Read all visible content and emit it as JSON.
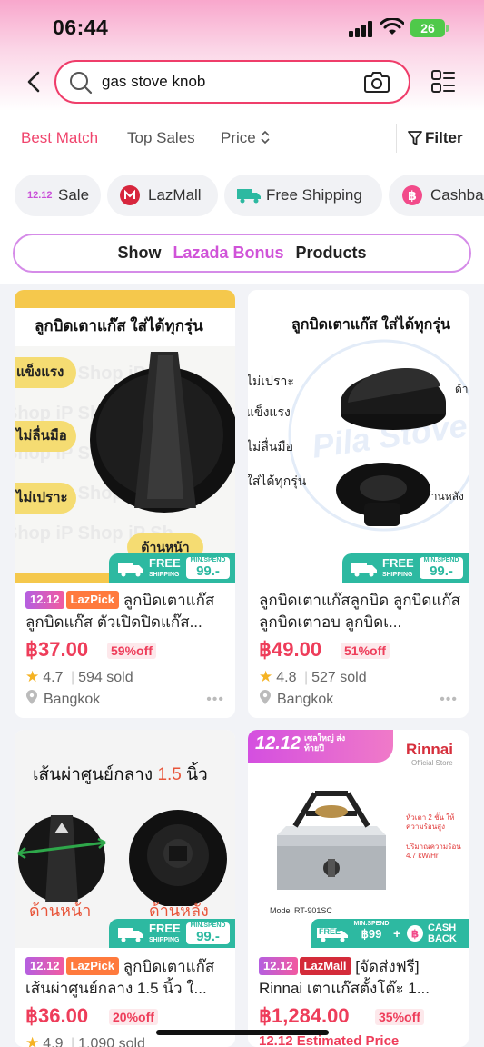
{
  "status_bar": {
    "time": "06:44",
    "battery": "26"
  },
  "search": {
    "query": "gas stove knob"
  },
  "sort": {
    "best_match": "Best Match",
    "top_sales": "Top Sales",
    "price": "Price",
    "filter": "Filter"
  },
  "chips": [
    {
      "badge": "12.12",
      "label": "Sale"
    },
    {
      "label": "LazMall"
    },
    {
      "label": "Free Shipping"
    },
    {
      "label": "Cashba"
    }
  ],
  "bonus": {
    "show": "Show",
    "lazada_bonus": "Lazada Bonus",
    "products": "Products"
  },
  "products": [
    {
      "image_title": "ลูกบิดเตาแก๊ส ใส่ได้ทุกรุ่น",
      "image_labels": [
        "แข็งแรง",
        "ไม่ลื่นมือ",
        "ไม่เปราะ",
        "ด้านหน้า"
      ],
      "watermark": "Shop iP Shop iP Sh",
      "tags": [
        "12.12",
        "LazPick"
      ],
      "title": "ลูกบิดเตาแก๊ส ลูกบิดแก๊ส ตัวเปิดปิดแก๊ส...",
      "price": "฿37.00",
      "discount": "59%off",
      "rating": "4.7",
      "sold": "594 sold",
      "location": "Bangkok",
      "shipping": {
        "free": "FREE",
        "free_sub": "SHIPPING",
        "min_label": "MIN.SPEND",
        "min_value": "99.-"
      }
    },
    {
      "image_title": "ลูกบิดเตาแก๊ส ใส่ได้ทุกรุ่น",
      "image_labels": [
        "ไม่เปราะ",
        "แข็งแรง",
        "ไม่ลื่นมือ",
        "ใส่ได้ทุกรุ่น",
        "ด้านหน้า",
        "ด้านหลัง"
      ],
      "watermark": "Pila Stove",
      "tags": [],
      "title": "ลูกบิดเตาแก๊สลูกบิด ลูกบิดแก๊ส ลูกบิดเตาอบ ลูกบิดเ...",
      "price": "฿49.00",
      "discount": "51%off",
      "rating": "4.8",
      "sold": "527 sold",
      "location": "Bangkok",
      "shipping": {
        "free": "FREE",
        "free_sub": "SHIPPING",
        "min_label": "MIN.SPEND",
        "min_value": "99.-"
      }
    },
    {
      "image_title": "เส้นผ่าศูนย์กลาง",
      "image_size": "1.5",
      "image_unit": "นิ้ว",
      "image_labels": [
        "ด้านหน้า",
        "ด้านหลัง"
      ],
      "tags": [
        "12.12",
        "LazPick"
      ],
      "title": "ลูกบิดเตาแก๊ส เส้นผ่าศูนย์กลาง 1.5 นิ้ว ใ...",
      "price": "฿36.00",
      "discount": "20%off",
      "rating": "4.9",
      "sold": "1,090 sold",
      "shipping": {
        "free": "FREE",
        "free_sub": "SHIPPING",
        "min_label": "MIN.SPEND",
        "min_value": "99.-"
      }
    },
    {
      "image_banner": "12.12",
      "image_banner_sub": "เซลใหญ่ ส่งท้ายปี",
      "brand": "Rinnai",
      "brand_sub": "Official Store",
      "image_notes": [
        "หัวเตา 2 ชั้น ให้ความร้อนสูง",
        "ปริมาณความร้อน 4.7 kW/Hr"
      ],
      "model": "Model  RT-901SC",
      "promo": {
        "free": "FREE",
        "min_label": "MIN.SPEND",
        "min_value": "฿99",
        "cash": "CASH BACK"
      },
      "tags": [
        "12.12",
        "LazMall"
      ],
      "title": "[จัดส่งฟรี] Rinnai เตาแก๊สตั้งโต๊ะ 1...",
      "price": "฿1,284.00",
      "discount": "35%off",
      "estimated": "12.12 Estimated Price"
    }
  ]
}
